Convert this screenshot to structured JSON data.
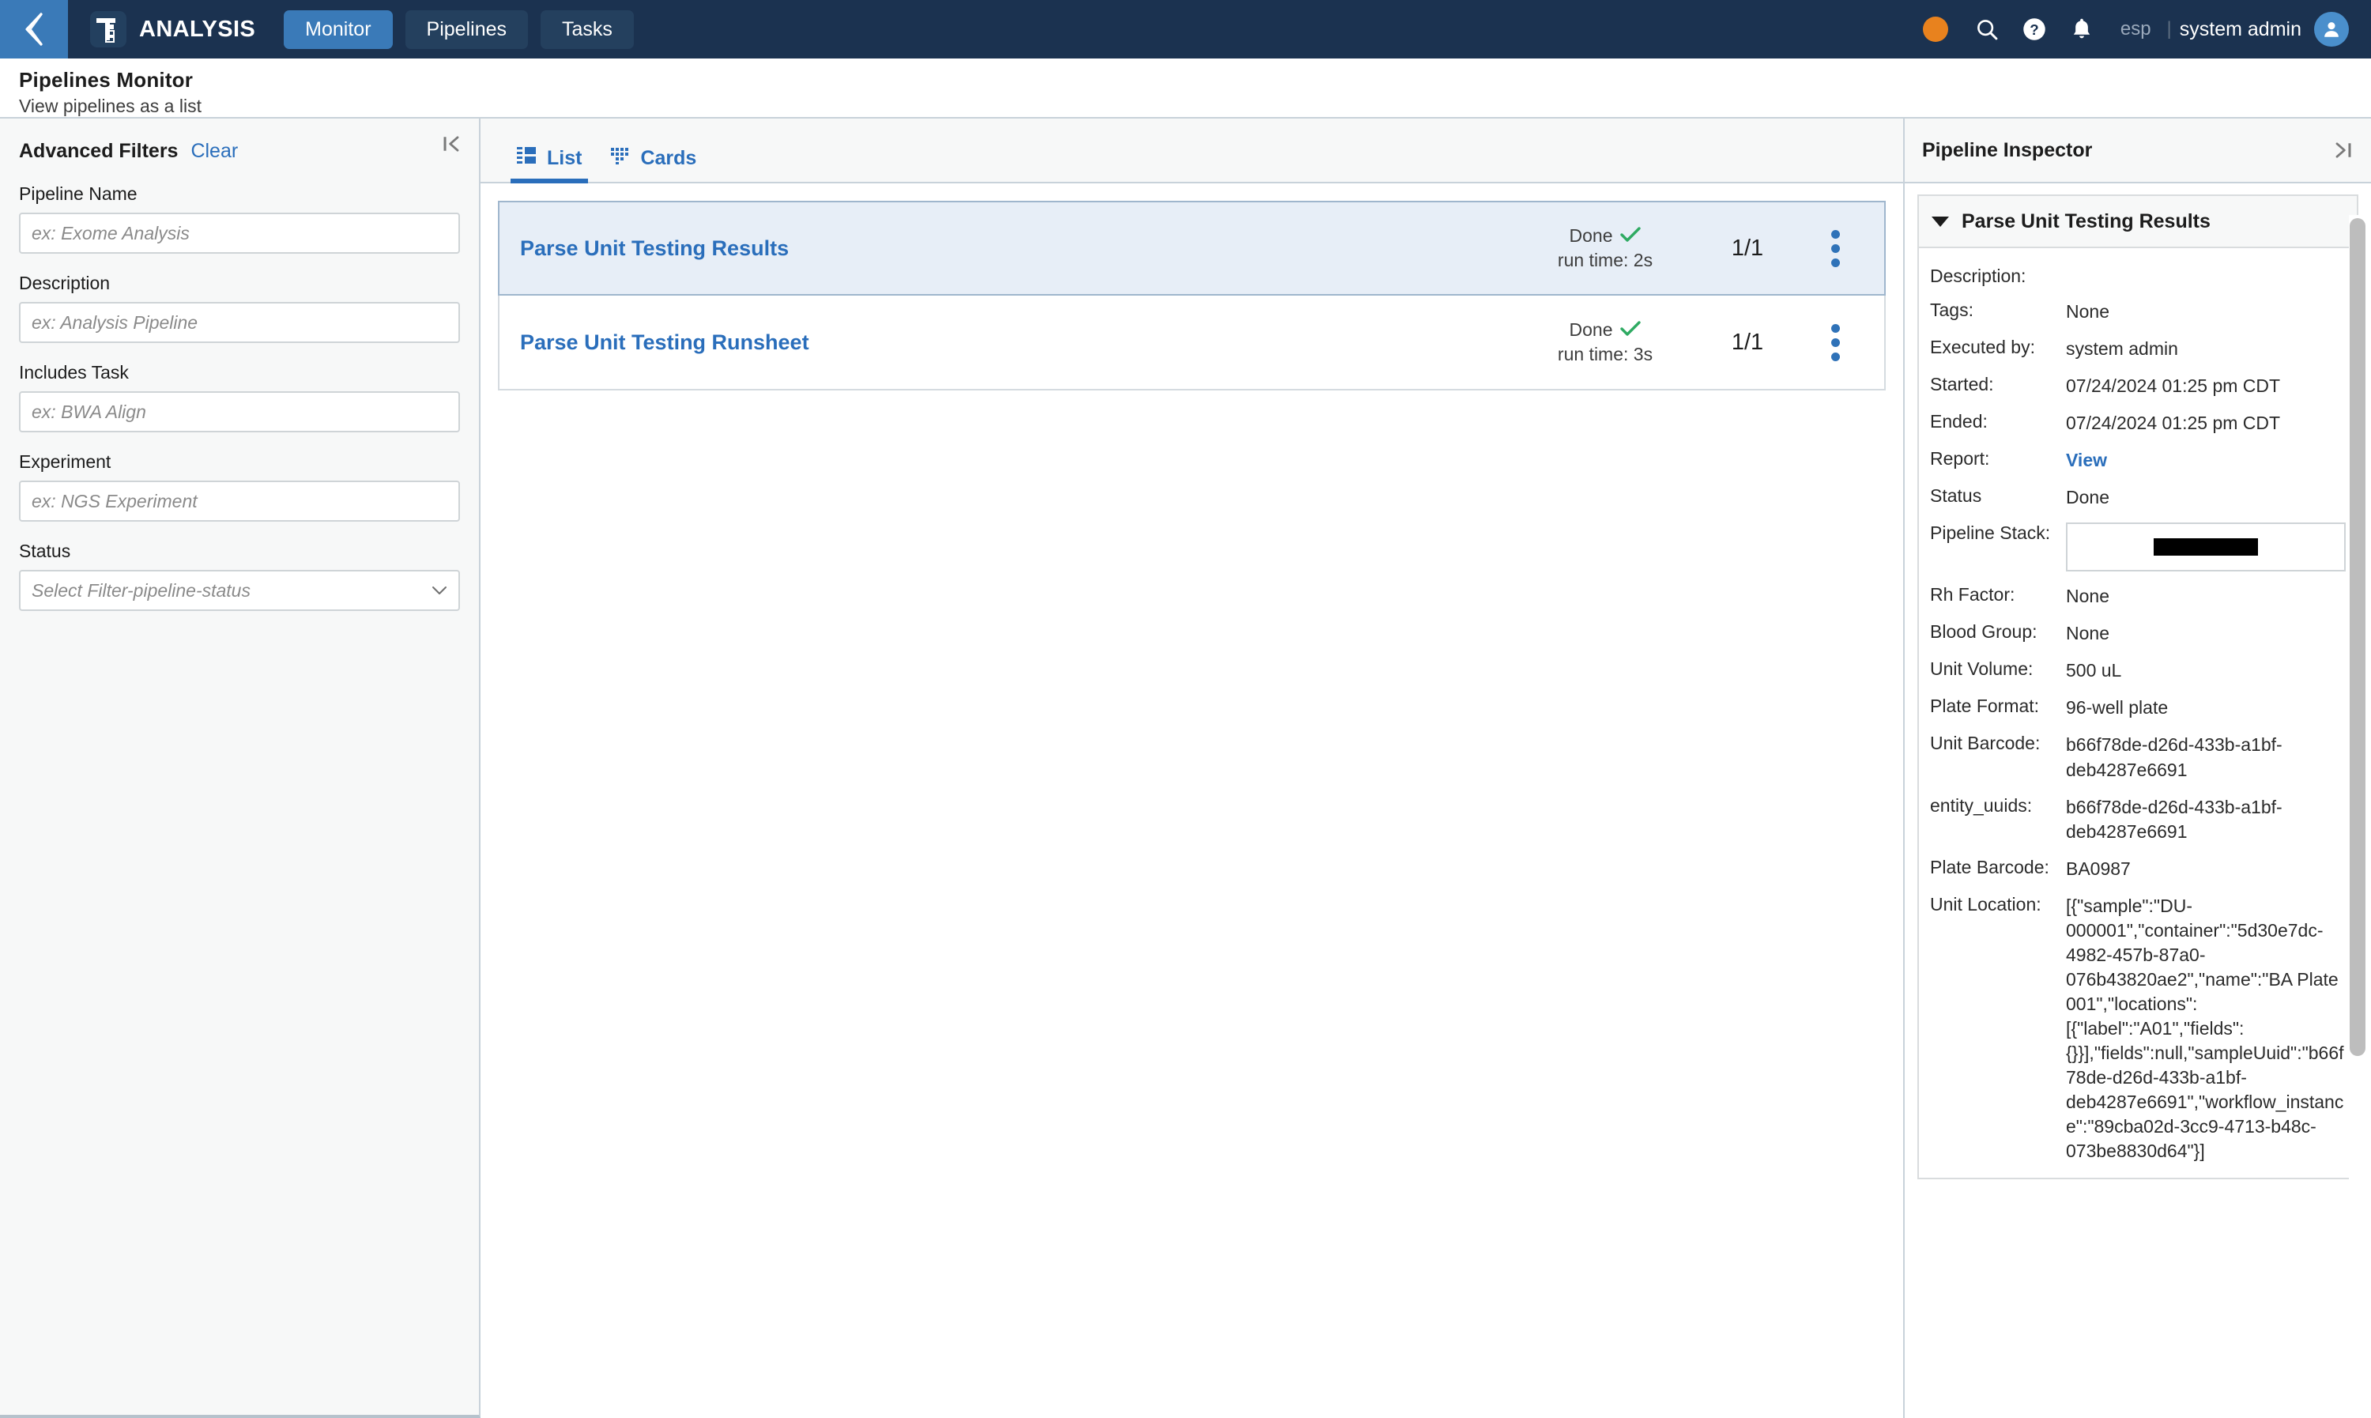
{
  "topnav": {
    "collapse_icon": "chevron-left-icon",
    "logo_icon": "analysis-logo-icon",
    "app_title": "ANALYSIS",
    "tabs": [
      {
        "label": "Monitor",
        "active": true
      },
      {
        "label": "Pipelines",
        "active": false
      },
      {
        "label": "Tasks",
        "active": false
      }
    ],
    "status_dot_color": "#e8821e",
    "icons": [
      "search-icon",
      "help-icon",
      "bell-icon"
    ],
    "language": "esp",
    "separator": "|",
    "user": "system admin",
    "avatar_icon": "user-avatar-icon"
  },
  "pagehead": {
    "title": "Pipelines Monitor",
    "subtitle": "View pipelines as a list"
  },
  "filters": {
    "title": "Advanced Filters",
    "clear_label": "Clear",
    "collapse_icon": "collapse-left-icon",
    "fields": [
      {
        "label": "Pipeline Name",
        "value": "",
        "placeholder": "ex: Exome Analysis",
        "type": "text"
      },
      {
        "label": "Description",
        "value": "",
        "placeholder": "ex: Analysis Pipeline",
        "type": "text"
      },
      {
        "label": "Includes Task",
        "value": "",
        "placeholder": "ex: BWA Align",
        "type": "text"
      },
      {
        "label": "Experiment",
        "value": "",
        "placeholder": "ex: NGS Experiment",
        "type": "text"
      },
      {
        "label": "Status",
        "value": "Select Filter-pipeline-status",
        "placeholder": "Select Filter-pipeline-status",
        "type": "select"
      }
    ]
  },
  "viewtabs": [
    {
      "label": "List",
      "icon": "list-view-icon",
      "active": true
    },
    {
      "label": "Cards",
      "icon": "cards-view-icon",
      "active": false
    }
  ],
  "pipelines": [
    {
      "name": "Parse Unit Testing Results",
      "status": "Done",
      "status_icon": "check-icon",
      "run_time": "run time: 2s",
      "count": "1/1",
      "menu_icon": "kebab-menu-icon",
      "selected": true
    },
    {
      "name": "Parse Unit Testing Runsheet",
      "status": "Done",
      "status_icon": "check-icon",
      "run_time": "run time: 3s",
      "count": "1/1",
      "menu_icon": "kebab-menu-icon",
      "selected": false
    }
  ],
  "inspector": {
    "title": "Pipeline Inspector",
    "collapse_icon": "collapse-right-icon",
    "card_title": "Parse Unit Testing Results",
    "caret_icon": "caret-down-icon",
    "fields": [
      {
        "key": "Description:",
        "value": ""
      },
      {
        "key": "Tags:",
        "value": "None"
      },
      {
        "key": "Executed by:",
        "value": "system admin"
      },
      {
        "key": "Started:",
        "value": "07/24/2024 01:25 pm CDT"
      },
      {
        "key": "Ended:",
        "value": "07/24/2024 01:25 pm CDT"
      },
      {
        "key": "Report:",
        "value": "View",
        "link": true
      },
      {
        "key": "Status",
        "value": "Done"
      },
      {
        "key": "Pipeline Stack:",
        "value": "",
        "redacted": true
      },
      {
        "key": "Rh Factor:",
        "value": "None"
      },
      {
        "key": "Blood Group:",
        "value": "None"
      },
      {
        "key": "Unit Volume:",
        "value": "500 uL"
      },
      {
        "key": "Plate Format:",
        "value": "96-well plate"
      },
      {
        "key": "Unit Barcode:",
        "value": "b66f78de-d26d-433b-a1bf-deb4287e6691"
      },
      {
        "key": "entity_uuids:",
        "value": "b66f78de-d26d-433b-a1bf-deb4287e6691"
      },
      {
        "key": "Plate Barcode:",
        "value": "BA0987"
      },
      {
        "key": "Unit Location:",
        "value": "[{\"sample\":\"DU-000001\",\"container\":\"5d30e7dc-4982-457b-87a0-076b43820ae2\",\"name\":\"BA Plate 001\",\"locations\":[{\"label\":\"A01\",\"fields\":{}}],\"fields\":null,\"sampleUuid\":\"b66f78de-d26d-433b-a1bf-deb4287e6691\",\"workflow_instance\":\"89cba02d-3cc9-4713-b48c-073be8830d64\"}]"
      }
    ]
  },
  "colors": {
    "nav_bg": "#1b3250",
    "nav_accent": "#3a7ab8",
    "link": "#2a6ebb",
    "selected_row": "#e7eef7",
    "done_check": "#2eaa62",
    "status_dot": "#e8821e"
  }
}
